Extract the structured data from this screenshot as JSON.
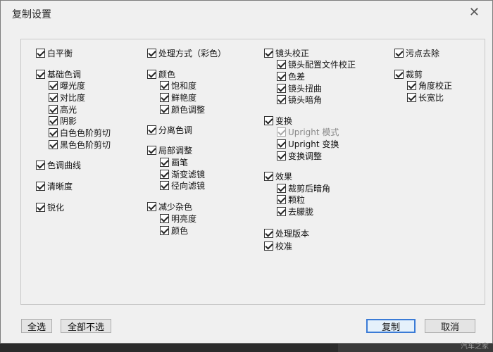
{
  "dialog": {
    "title": "复制设置",
    "close_icon": "close-icon"
  },
  "columns": {
    "c1": {
      "white_balance": "白平衡",
      "basic_tone": "基础色调",
      "exposure": "曝光度",
      "contrast": "对比度",
      "highlights": "高光",
      "shadows": "阴影",
      "white_clip": "白色色阶剪切",
      "black_clip": "黑色色阶剪切",
      "tone_curve": "色调曲线",
      "clarity": "清晰度",
      "sharpening": "锐化"
    },
    "c2": {
      "treatment": "处理方式（彩色）",
      "color": "颜色",
      "saturation": "饱和度",
      "vibrance": "鲜艳度",
      "color_adjust": "颜色调整",
      "split_toning": "分离色调",
      "local_adjust": "局部调整",
      "brush": "画笔",
      "graduated_filter": "渐变滤镜",
      "radial_filter": "径向滤镜",
      "noise_reduction": "减少杂色",
      "luminance": "明亮度",
      "nr_color": "颜色"
    },
    "c3": {
      "lens_corrections": "镜头校正",
      "profile_correction": "镜头配置文件校正",
      "chromatic": "色差",
      "distortion": "镜头扭曲",
      "vignetting": "镜头暗角",
      "transform": "变换",
      "upright_mode": "Upright 模式",
      "upright_transform": "Upright 变换",
      "transform_adjust": "变换调整",
      "effects": "效果",
      "post_crop_vignette": "裁剪后暗角",
      "grain": "颗粒",
      "dehaze": "去朦胧",
      "process_version": "处理版本",
      "calibration": "校准"
    },
    "c4": {
      "spot_removal": "污点去除",
      "crop": "裁剪",
      "straighten_angle": "角度校正",
      "aspect_ratio": "长宽比"
    }
  },
  "buttons": {
    "select_all": "全选",
    "select_none": "全部不选",
    "copy": "复制",
    "cancel": "取消"
  },
  "watermark": "汽车之家"
}
